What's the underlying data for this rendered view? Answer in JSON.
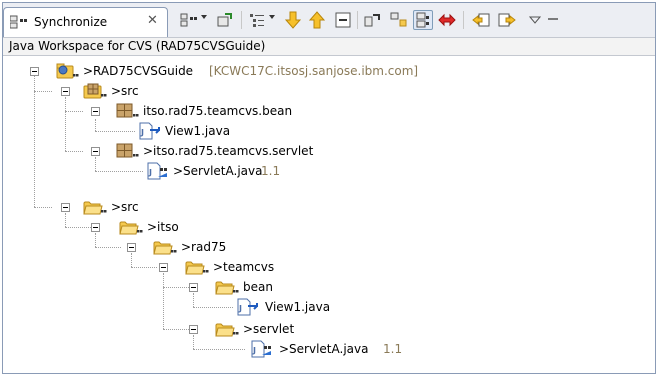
{
  "view": {
    "tab_title": "Synchronize",
    "description": "Java Workspace for CVS (RAD75CVSGuide)"
  },
  "toolbar": {
    "buttons": [
      {
        "name": "synchronize-dropdown-icon"
      },
      {
        "name": "pin-icon"
      },
      {
        "name": "presentation-dropdown-icon"
      },
      {
        "name": "next-difference-arrow-icon"
      },
      {
        "name": "previous-difference-arrow-icon"
      },
      {
        "name": "collapse-all-icon"
      },
      {
        "name": "incoming-mode-icon"
      },
      {
        "name": "outgoing-mode-icon"
      },
      {
        "name": "incoming-outgoing-mode-icon"
      },
      {
        "name": "conflicts-mode-icon"
      },
      {
        "name": "update-all-icon"
      },
      {
        "name": "commit-all-icon"
      },
      {
        "name": "view-menu-icon"
      },
      {
        "name": "minimize-icon"
      }
    ]
  },
  "tree": {
    "root": {
      "label": ">RAD75CVSGuide",
      "location": "[KCWC17C.itsosj.sanjose.ibm.com]"
    },
    "nodes": [
      {
        "label": ">src"
      },
      {
        "label": "itso.rad75.teamcvs.bean"
      },
      {
        "label": "View1.java"
      },
      {
        "label": ">itso.rad75.teamcvs.servlet"
      },
      {
        "label": ">ServletA.java",
        "revision": "1.1"
      },
      {
        "label": ">src"
      },
      {
        "label": ">itso"
      },
      {
        "label": ">rad75"
      },
      {
        "label": ">teamcvs"
      },
      {
        "label": "bean"
      },
      {
        "label": "View1.java"
      },
      {
        "label": ">servlet"
      },
      {
        "label": ">ServletA.java",
        "revision": "1.1"
      }
    ]
  }
}
